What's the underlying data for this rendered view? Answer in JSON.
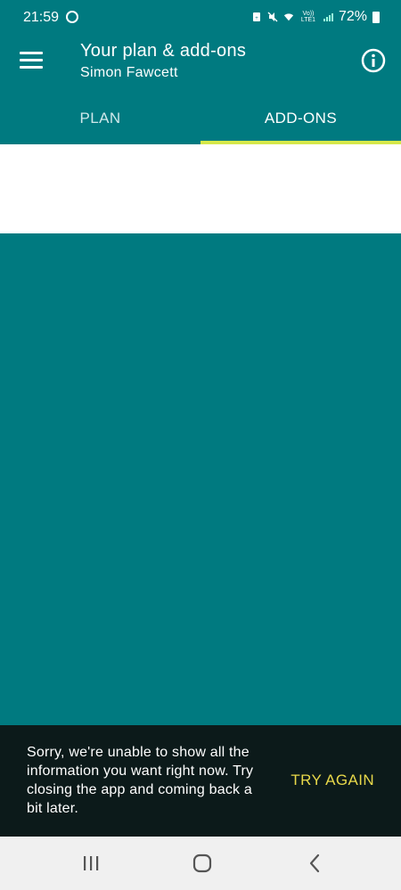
{
  "status_bar": {
    "time": "21:59",
    "battery": "72%",
    "icons": [
      "whatsapp-icon",
      "battery-saver-icon",
      "mute-icon",
      "wifi-icon",
      "volte-lte-icon",
      "signal-icon",
      "battery-icon"
    ],
    "volte_top": "Vo))",
    "volte_bottom": "LTE1"
  },
  "app_bar": {
    "title": "Your plan & add-ons",
    "subtitle": "Simon Fawcett",
    "menu_icon": "hamburger-menu-icon",
    "info_icon": "info-icon"
  },
  "tabs": [
    {
      "label": "PLAN",
      "selected": false
    },
    {
      "label": "ADD-ONS",
      "selected": true
    }
  ],
  "snackbar": {
    "message": "Sorry, we're unable to show all the information you want right now. Try closing the app and coming back a bit later.",
    "action": "TRY AGAIN"
  },
  "nav_bar": {
    "buttons": [
      "recent-apps-icon",
      "home-icon",
      "back-icon"
    ]
  },
  "colors": {
    "primary": "#007a80",
    "tab_indicator": "#d6e84a",
    "snackbar_bg": "#0c1a1a",
    "snackbar_action": "#e8d84a",
    "nav_bg": "#f0f0f0"
  }
}
